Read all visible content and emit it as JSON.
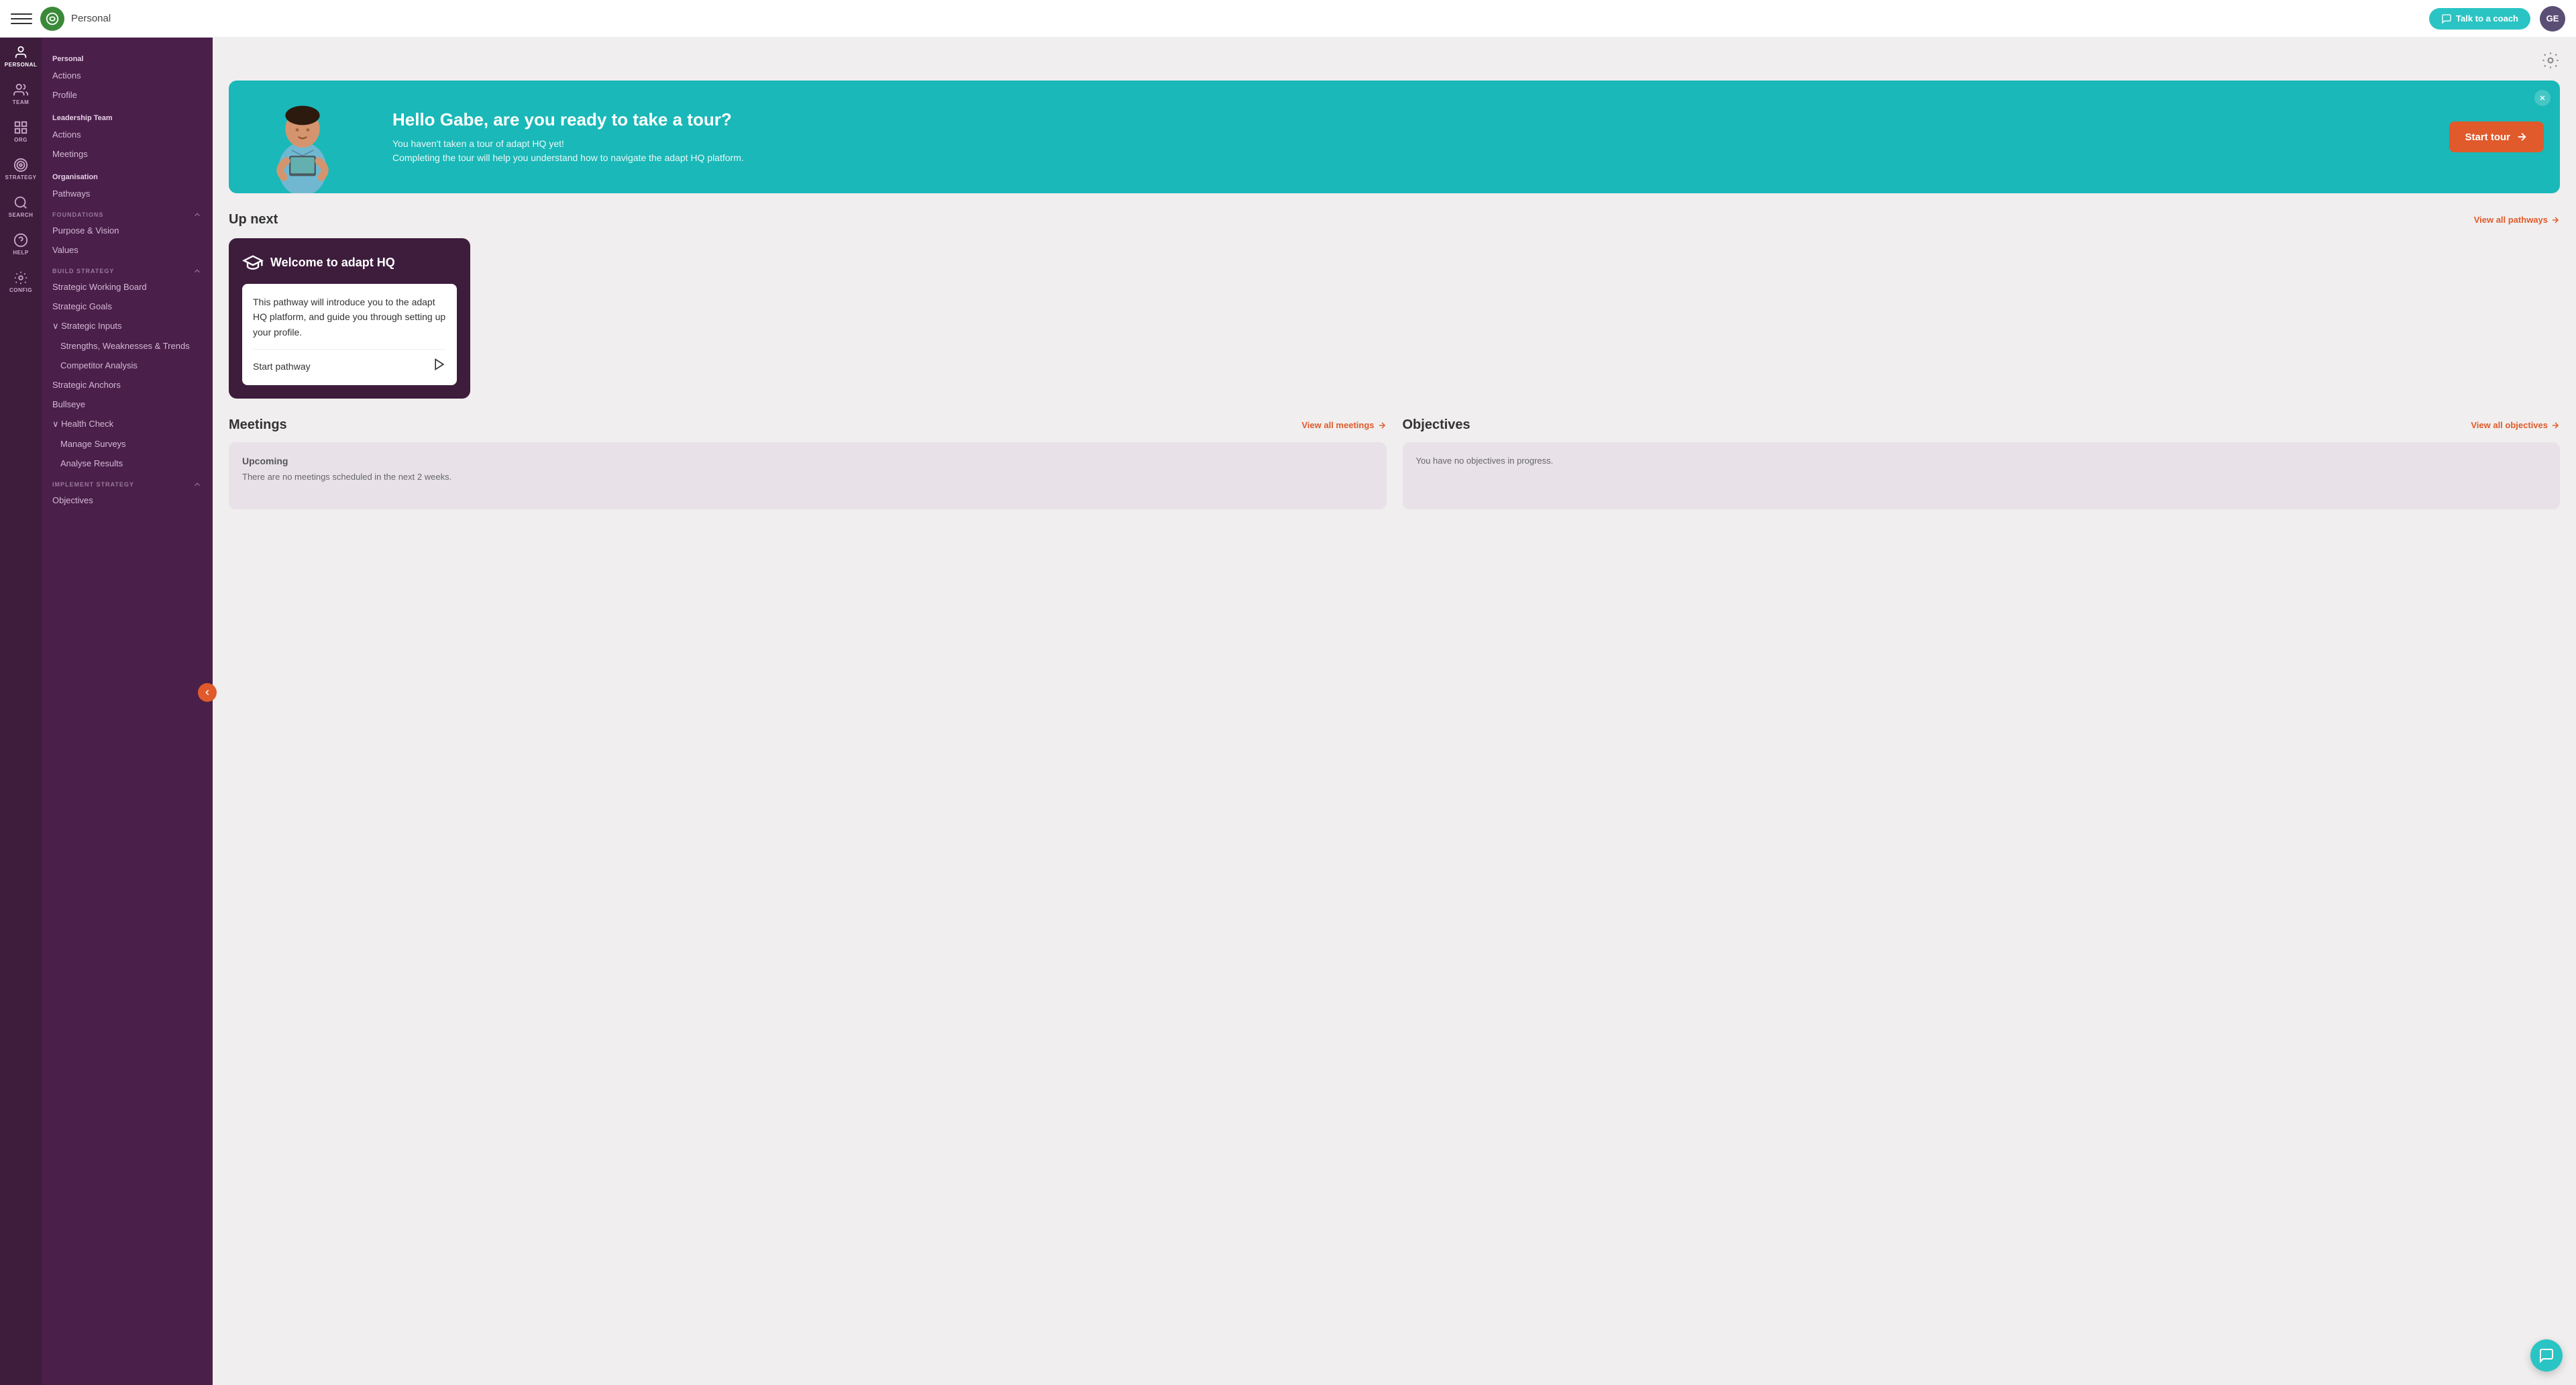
{
  "topbar": {
    "logo_alt": "adapt HQ logo",
    "title": "Personal",
    "talk_to_coach_label": "Talk to a coach",
    "avatar_initials": "GE"
  },
  "sidebar_left": {
    "items": [
      {
        "id": "personal",
        "label": "PERSONAL",
        "active": true
      },
      {
        "id": "team",
        "label": "TEAM",
        "active": false
      },
      {
        "id": "org",
        "label": "ORG",
        "active": false
      },
      {
        "id": "strategy",
        "label": "STRATEGY",
        "active": false
      },
      {
        "id": "search",
        "label": "SEARCH",
        "active": false
      },
      {
        "id": "help",
        "label": "HELP",
        "active": false
      },
      {
        "id": "config",
        "label": "CONFIG",
        "active": false
      }
    ]
  },
  "sidebar_nav": {
    "personal_section": "Personal",
    "personal_links": [
      {
        "label": "Actions",
        "level": "top"
      },
      {
        "label": "Profile",
        "level": "top"
      }
    ],
    "leadership_section": "Leadership Team",
    "leadership_links": [
      {
        "label": "Actions",
        "level": "top"
      },
      {
        "label": "Meetings",
        "level": "top"
      }
    ],
    "organisation_section": "Organisation",
    "organisation_links": [
      {
        "label": "Pathways",
        "level": "top"
      }
    ],
    "foundations_section": "FOUNDATIONS",
    "foundations_links": [
      {
        "label": "Purpose & Vision",
        "level": "top"
      },
      {
        "label": "Values",
        "level": "top"
      }
    ],
    "build_strategy_section": "BUILD STRATEGY",
    "build_strategy_links": [
      {
        "label": "Strategic Working Board",
        "level": "top"
      },
      {
        "label": "Strategic Goals",
        "level": "top"
      },
      {
        "label": "Strategic Inputs",
        "level": "top",
        "expanded": true
      },
      {
        "label": "Strengths, Weaknesses & Trends",
        "level": "sub"
      },
      {
        "label": "Competitor Analysis",
        "level": "sub"
      },
      {
        "label": "Strategic Anchors",
        "level": "top"
      },
      {
        "label": "Bullseye",
        "level": "top"
      },
      {
        "label": "Health Check",
        "level": "top",
        "expanded": true
      },
      {
        "label": "Manage Surveys",
        "level": "sub"
      },
      {
        "label": "Analyse Results",
        "level": "sub"
      }
    ],
    "implement_strategy_section": "IMPLEMENT STRATEGY",
    "implement_strategy_links": [
      {
        "label": "Objectives",
        "level": "top"
      }
    ]
  },
  "banner": {
    "greeting": "Hello Gabe, are you ready to take a tour?",
    "line1": "You haven't taken a tour of adapt HQ yet!",
    "line2": "Completing the tour will help you understand how to navigate the adapt HQ platform.",
    "cta_label": "Start tour"
  },
  "up_next": {
    "section_title": "Up next",
    "view_all_label": "View all pathways",
    "pathway_icon": "graduation-cap",
    "pathway_title": "Welcome to adapt HQ",
    "pathway_description": "This pathway will introduce you to the adapt HQ platform, and guide you through setting up your profile.",
    "start_label": "Start pathway"
  },
  "meetings": {
    "section_title": "Meetings",
    "view_all_label": "View all meetings",
    "upcoming_label": "Upcoming",
    "upcoming_text": "There are no meetings scheduled in the next 2 weeks."
  },
  "objectives": {
    "section_title": "Objectives",
    "view_all_label": "View all objectives",
    "empty_text": "You have no objectives in progress."
  },
  "chat": {
    "label": "Chat bubble"
  },
  "colors": {
    "accent": "#e05a2b",
    "teal": "#1ab8b8",
    "sidebar_dark": "#4a1f4a",
    "sidebar_darker": "#3d1c3c",
    "avatar_bg": "#5b4e75"
  }
}
